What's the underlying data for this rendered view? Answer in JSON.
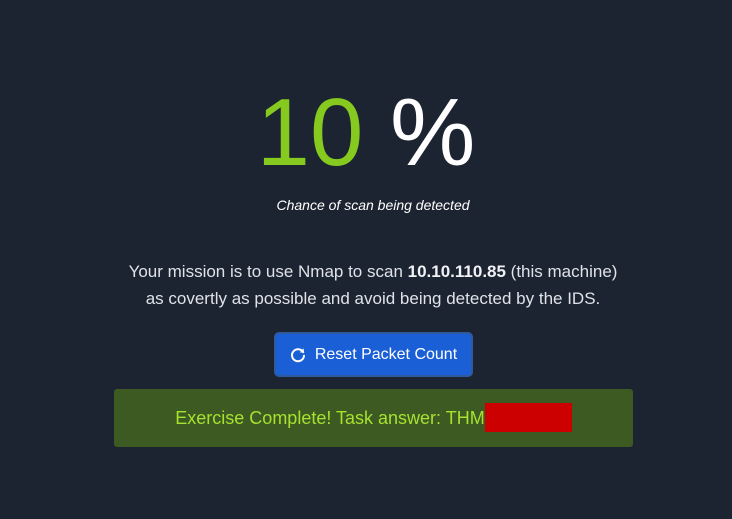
{
  "detection": {
    "percent_value": "10",
    "percent_sign": "%",
    "caption": "Chance of scan being detected"
  },
  "mission": {
    "text_before": "Your mission is to use Nmap to scan ",
    "target_ip": "10.10.110.85",
    "text_after": " (this machine)",
    "line2": "as covertly as possible and avoid being detected by the IDS."
  },
  "reset_button": {
    "label": "Reset Packet Count",
    "icon": "refresh-icon"
  },
  "alert": {
    "text": "Exercise Complete! Task answer: THM",
    "redaction_color": "#cc0000"
  },
  "colors": {
    "background": "#1c2331",
    "accent_green": "#86c91f",
    "button_blue": "#1a5fd6",
    "alert_bg": "#3d5a23",
    "alert_text": "#a6e22e"
  }
}
